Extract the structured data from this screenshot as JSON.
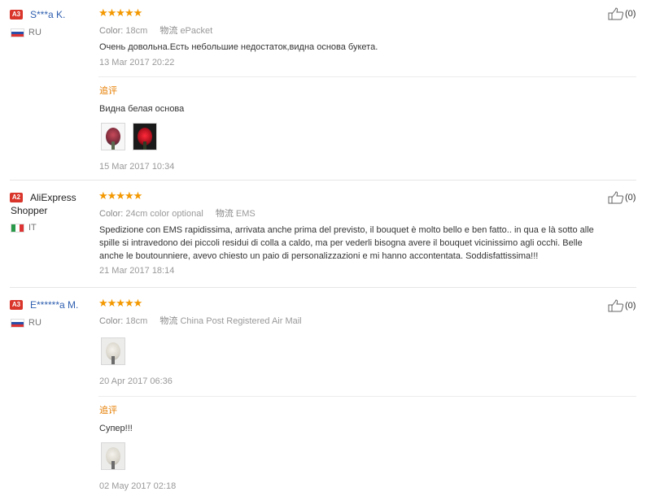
{
  "followup_label": "追评",
  "reviews": [
    {
      "badge": "A3",
      "name": "S***a K.",
      "country": "RU",
      "stars": "★★★★★",
      "color_key": "Color:",
      "color_value": "18cm",
      "ship_key": "物流",
      "ship_value": "ePacket",
      "text": "Очень довольна.Есть небольшие недостаток,видна основа букета.",
      "date": "13 Mar 2017 20:22",
      "helpful": "(0)",
      "followup_text": "Видна белая основа",
      "followup_date": "15 Mar 2017 10:34"
    },
    {
      "badge": "A2",
      "name_line1": "AliExpress",
      "name_line2": "Shopper",
      "country": "IT",
      "stars": "★★★★★",
      "color_key": "Color:",
      "color_value": "24cm color optional",
      "ship_key": "物流",
      "ship_value": "EMS",
      "text_line1": "Spedizione con EMS rapidissima, arrivata anche prima del previsto, il bouquet è molto bello e ben fatto.. in qua e là sotto alle",
      "text_line2": "spille si intravedono dei piccoli residui di colla a caldo, ma per vederli bisogna avere il bouquet vicinissimo agli occhi. Belle",
      "text_line3": "anche le boutounniere, avevo chiesto un paio di personalizzazioni e mi hanno accontentata. Soddisfattissima!!!",
      "date": "21 Mar 2017 18:14",
      "helpful": "(0)"
    },
    {
      "badge": "A3",
      "name": "E******a M.",
      "country": "RU",
      "stars": "★★★★★",
      "color_key": "Color:",
      "color_value": "18cm",
      "ship_key": "物流",
      "ship_value": "China Post Registered Air Mail",
      "date": "20 Apr 2017 06:36",
      "helpful": "(0)",
      "followup_text": "Супер!!!",
      "followup_date": "02 May 2017 02:18"
    }
  ],
  "colors": {
    "star": "#f39800",
    "badge": "#d9352b",
    "name_link": "#3060b0",
    "followup": "#e67e00"
  }
}
